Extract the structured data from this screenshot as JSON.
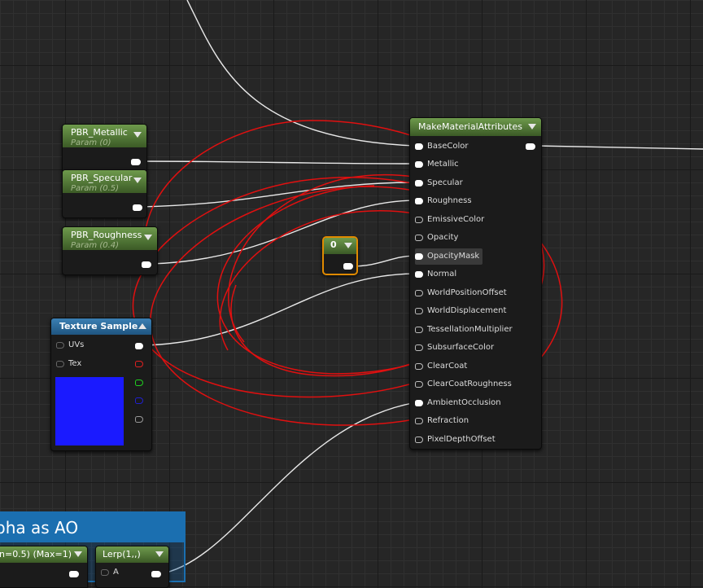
{
  "nodes": {
    "pbr_metallic": {
      "title": "PBR_Metallic",
      "subtitle": "Param (0)"
    },
    "pbr_specular": {
      "title": "PBR_Specular",
      "subtitle": "Param (0.5)"
    },
    "pbr_roughness": {
      "title": "PBR_Roughness",
      "subtitle": "Param (0.4)"
    },
    "constant": {
      "value": "0"
    },
    "texture_sample": {
      "title": "Texture Sample",
      "inputs": [
        "UVs",
        "Tex"
      ],
      "preview_color": "#1a1aff"
    },
    "make_material_attributes": {
      "title": "MakeMaterialAttributes",
      "inputs": [
        "BaseColor",
        "Metallic",
        "Specular",
        "Roughness",
        "EmissiveColor",
        "Opacity",
        "OpacityMask",
        "Normal",
        "WorldPositionOffset",
        "WorldDisplacement",
        "TessellationMultiplier",
        "SubsurfaceColor",
        "ClearCoat",
        "ClearCoatRoughness",
        "AmbientOcclusion",
        "Refraction",
        "PixelDepthOffset"
      ]
    },
    "comment": {
      "title": "pha as AO"
    },
    "param_partial": {
      "title": "n=0.5) (Max=1)"
    },
    "lerp": {
      "title": "Lerp(1,,)",
      "input": "A"
    }
  },
  "colors": {
    "header_green": "#4e7436",
    "texture_header_blue": "#2a6797",
    "comment_blue": "#1b6fb0",
    "selection_orange": "#e08a00",
    "annotation_red": "#e01010",
    "pin_red": "#e02020",
    "pin_green": "#20d020",
    "pin_blue": "#2020d0"
  }
}
